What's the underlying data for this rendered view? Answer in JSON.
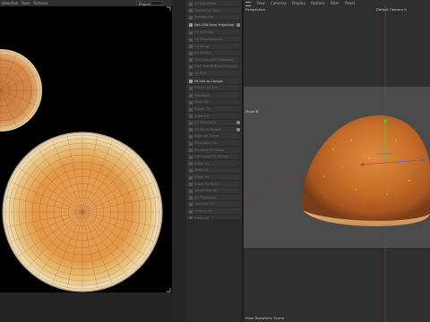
{
  "uv_menu": {
    "items": [
      "Selection",
      "Tools",
      "Textures"
    ],
    "dropdown_value": "Project"
  },
  "tools": [
    {
      "label": "UV Edit Mode",
      "active": false
    },
    {
      "label": "Texture UV Pack",
      "active": false
    },
    {
      "label": "Realign UVs",
      "active": false
    },
    {
      "label": "Set UVW from Projection",
      "active": true,
      "gear": true
    },
    {
      "label": "UV Settings",
      "active": false
    },
    {
      "label": "UV Relax/Unwrap",
      "active": false
    },
    {
      "label": "UV Mirror",
      "active": false
    },
    {
      "label": "UV Stretch",
      "active": false
    },
    {
      "label": "Grid Snap/Rect Mapping",
      "active": false
    },
    {
      "label": "Pack Islands/Rect Mapping",
      "active": false
    },
    {
      "label": "UV Pack",
      "active": false
    },
    {
      "label": "Fit UVs to Canvas",
      "active": true
    },
    {
      "label": "Fit UVs to Grid",
      "active": false
    },
    {
      "label": "Transform",
      "active": false
    },
    {
      "label": "Move UV",
      "active": false
    },
    {
      "label": "Rotate UV",
      "active": false
    },
    {
      "label": "Scale UV",
      "active": false
    },
    {
      "label": "UV Transform",
      "active": false,
      "gear": true
    },
    {
      "label": "UV Mirror/Rotate",
      "active": false,
      "gear": true
    },
    {
      "label": "Align UV Points",
      "active": false
    },
    {
      "label": "Straighten UV",
      "active": false
    },
    {
      "label": "Equalize UV Points",
      "active": false
    },
    {
      "label": "Normalize UV Islands",
      "active": false
    },
    {
      "label": "Stitch UV",
      "active": false
    },
    {
      "label": "Weld UV",
      "active": false
    },
    {
      "label": "Break UV",
      "active": false
    },
    {
      "label": "Invert UV Shell",
      "active": false
    },
    {
      "label": "Select Islands",
      "active": false
    },
    {
      "label": "UV Projection",
      "active": false
    },
    {
      "label": "Optimize UV",
      "active": false
    },
    {
      "label": "Unwrap UV",
      "active": false
    },
    {
      "label": "Relax UV",
      "active": false
    }
  ],
  "viewport": {
    "menu": [
      "View",
      "Cameras",
      "Display",
      "Options",
      "Filter",
      "Panel"
    ],
    "label": "Perspective",
    "camera": "Default Camera ⊙",
    "plane_label": "Move ⊕",
    "footer": "View Transform: Scene"
  },
  "colors": {
    "accent": "#8aa0b8",
    "uv_bg": "#000000",
    "viewport_bg": "#4a4a4a"
  }
}
